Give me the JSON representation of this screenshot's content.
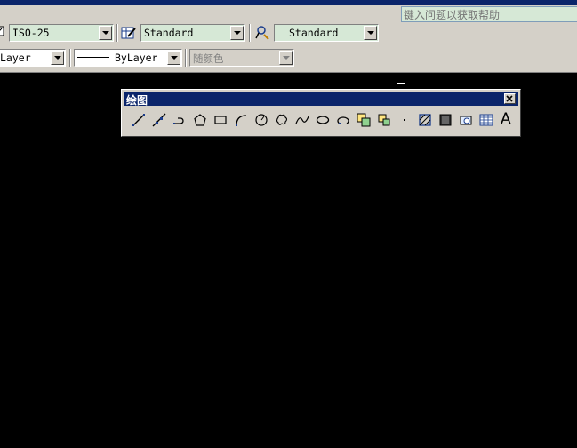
{
  "help": {
    "placeholder": "键入问题以获取帮助"
  },
  "styles": {
    "dim_style": "ISO-25",
    "table_style": "Standard",
    "mleader_style": "Standard"
  },
  "properties": {
    "layer": "Layer",
    "linetype": "ByLayer",
    "color": "随颜色"
  },
  "draw_toolbar": {
    "title": "绘图",
    "tools": [
      "line-icon",
      "construction-line-icon",
      "polyline-icon",
      "polygon-icon",
      "rectangle-icon",
      "arc-icon",
      "circle-icon",
      "revision-cloud-icon",
      "spline-icon",
      "ellipse-icon",
      "ellipse-arc-icon",
      "insert-block-icon",
      "make-block-icon",
      "point-icon",
      "hatch-icon",
      "gradient-icon",
      "region-icon",
      "table-icon",
      "multiline-text-icon"
    ],
    "text_tool_label": "A"
  },
  "colors": {
    "titlebar": "#0a246a",
    "toolbar_bg": "#d4d0c8",
    "combo_bg": "#d6e8d6",
    "canvas": "#000000"
  }
}
